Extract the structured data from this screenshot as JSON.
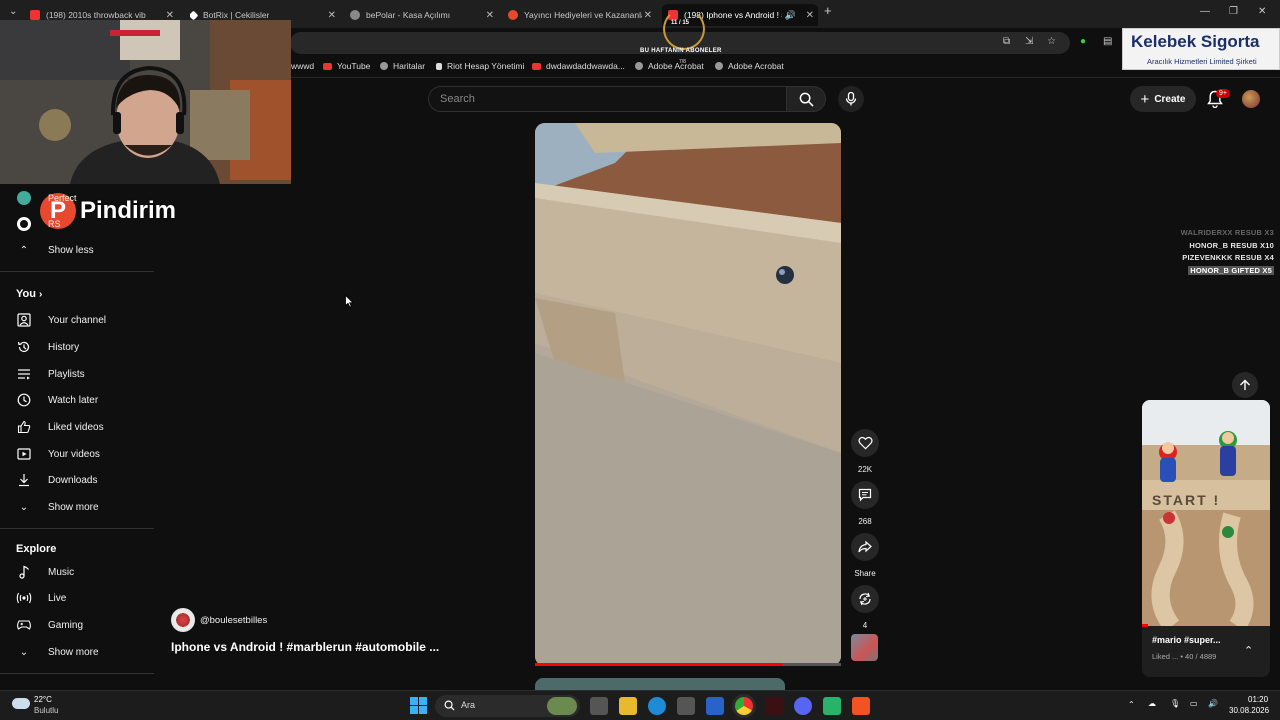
{
  "tabs": [
    {
      "title": "(198) 2010s throwback vib",
      "active": false
    },
    {
      "title": "BotRix | Cekilisler",
      "active": false
    },
    {
      "title": "bePolar - Kasa Açılımı",
      "active": false
    },
    {
      "title": "Yayıncı Hediyeleri ve Kazananla",
      "active": false
    },
    {
      "title": "(198) Iphone vs Android ! #",
      "active": true
    }
  ],
  "bookmarks": [
    "wwwd",
    "YouTube",
    "Haritalar",
    "Riot Hesap Yönetimi",
    "dwdawdaddwawda...",
    "Adobe Acrobat",
    "Adobe Acrobat"
  ],
  "overlay": {
    "weekly_subs": "BU HAFTANIN ABONELER",
    "ring_count": "11 / 15",
    "ring_sub": "7/8"
  },
  "sponsor": {
    "name": "Kelebek Sigorta",
    "tagline": "Aracılık Hizmetleri Limited Şirketi"
  },
  "pindirim": {
    "letter": "P",
    "text": "Pindirim"
  },
  "search": {
    "placeholder": "Search"
  },
  "header": {
    "create_label": "Create",
    "notif_badge": "9+"
  },
  "sidebar": {
    "partial": [
      {
        "label": "Perfect"
      },
      {
        "label": "RS"
      }
    ],
    "show_less": "Show less",
    "you": {
      "heading": "You",
      "items": [
        {
          "label": "Your channel",
          "icon": "user-icon"
        },
        {
          "label": "History",
          "icon": "history-icon"
        },
        {
          "label": "Playlists",
          "icon": "playlist-icon"
        },
        {
          "label": "Watch later",
          "icon": "clock-icon"
        },
        {
          "label": "Liked videos",
          "icon": "thumbs-up-icon"
        },
        {
          "label": "Your videos",
          "icon": "video-icon"
        },
        {
          "label": "Downloads",
          "icon": "download-icon"
        },
        {
          "label": "Show more",
          "icon": "chevron-down-icon"
        }
      ]
    },
    "explore": {
      "heading": "Explore",
      "items": [
        {
          "label": "Music",
          "icon": "music-icon"
        },
        {
          "label": "Live",
          "icon": "live-icon"
        },
        {
          "label": "Gaming",
          "icon": "gaming-icon"
        },
        {
          "label": "Show more",
          "icon": "chevron-down-icon"
        }
      ]
    }
  },
  "short": {
    "channel": "@boulesetbilles",
    "title": "Iphone vs Android ! #marblerun #automobile ...",
    "progress": 0.81,
    "actions": {
      "likes": "22K",
      "comments": "268",
      "share": "Share",
      "remix": "4"
    }
  },
  "sub_alerts": [
    {
      "text": "WALRIDERXX RESUB X3",
      "style": "dim"
    },
    {
      "text": "HONOR_B RESUB X10",
      "style": "normal"
    },
    {
      "text": "PIZEVENKKK RESUB X4",
      "style": "normal"
    },
    {
      "text": "HONOR_B GIFTED X5",
      "style": "hl"
    }
  ],
  "miniplayer": {
    "title": "#mario #super...",
    "subtitle": "Liked ... • 40 / 4889",
    "sign": "START !"
  },
  "taskbar": {
    "weather_temp": "22°C",
    "weather_desc": "Bulutlu",
    "search": "Ara",
    "time": "01:20",
    "date": "30.08.2026"
  }
}
